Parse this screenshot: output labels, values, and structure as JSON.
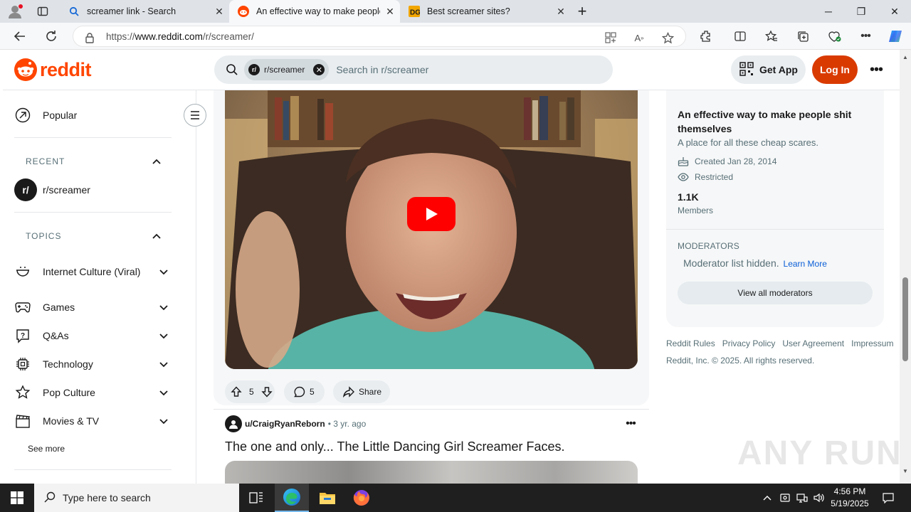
{
  "browser": {
    "tabs": [
      {
        "title": "screamer link - Search",
        "favicon": "bing-search-icon"
      },
      {
        "title": "An effective way to make people",
        "favicon": "reddit-icon"
      },
      {
        "title": "Best screamer sites?",
        "favicon": "site-dg-icon"
      }
    ],
    "new_tab": "+",
    "url_prefix": "https://",
    "url_host": "www.reddit.com",
    "url_path": "/r/screamer/"
  },
  "header": {
    "logo_text": "reddit",
    "search_chip": "r/screamer",
    "search_chip_badge": "r/",
    "search_placeholder": "Search in r/screamer",
    "get_app": "Get App",
    "login": "Log In",
    "more": "•••"
  },
  "sidebar": {
    "popular": "Popular",
    "recent_header": "RECENT",
    "recent_item": "r/screamer",
    "recent_badge": "r/",
    "topics_header": "TOPICS",
    "topics": [
      {
        "label": "Internet Culture (Viral)",
        "icon": "smile-icon"
      },
      {
        "label": "Games",
        "icon": "gamepad-icon"
      },
      {
        "label": "Q&As",
        "icon": "question-icon"
      },
      {
        "label": "Technology",
        "icon": "chip-icon"
      },
      {
        "label": "Pop Culture",
        "icon": "star-icon"
      },
      {
        "label": "Movies & TV",
        "icon": "clapperboard-icon"
      }
    ],
    "see_more": "See more"
  },
  "post1": {
    "upvotes": "5",
    "comments": "5",
    "share": "Share"
  },
  "post2": {
    "user": "u/CraigRyanReborn",
    "time": "• 3 yr. ago",
    "title": "The one and only... The Little Dancing Girl Screamer Faces.",
    "more": "•••"
  },
  "about": {
    "title": "An effective way to make people shit themselves",
    "description": "A place for all these cheap scares.",
    "created": "Created Jan 28, 2014",
    "restricted": "Restricted",
    "members_count": "1.1K",
    "members_label": "Members",
    "moderators_header": "MODERATORS",
    "moderators_hidden": "Moderator list hidden.",
    "learn_more": "Learn More",
    "view_all_mods": "View all moderators"
  },
  "footer": {
    "links": [
      "Reddit Rules",
      "Privacy Policy",
      "User Agreement",
      "Impressum"
    ],
    "copyright": "Reddit, Inc. © 2025. All rights reserved."
  },
  "watermark": "ANY RUN",
  "taskbar": {
    "search_placeholder": "Type here to search",
    "time": "4:56 PM",
    "date": "5/19/2025"
  },
  "colors": {
    "reddit_orange": "#ff4500",
    "login_bg": "#d93a00",
    "youtube_red": "#ff0000",
    "link_blue": "#0a5ed7"
  }
}
